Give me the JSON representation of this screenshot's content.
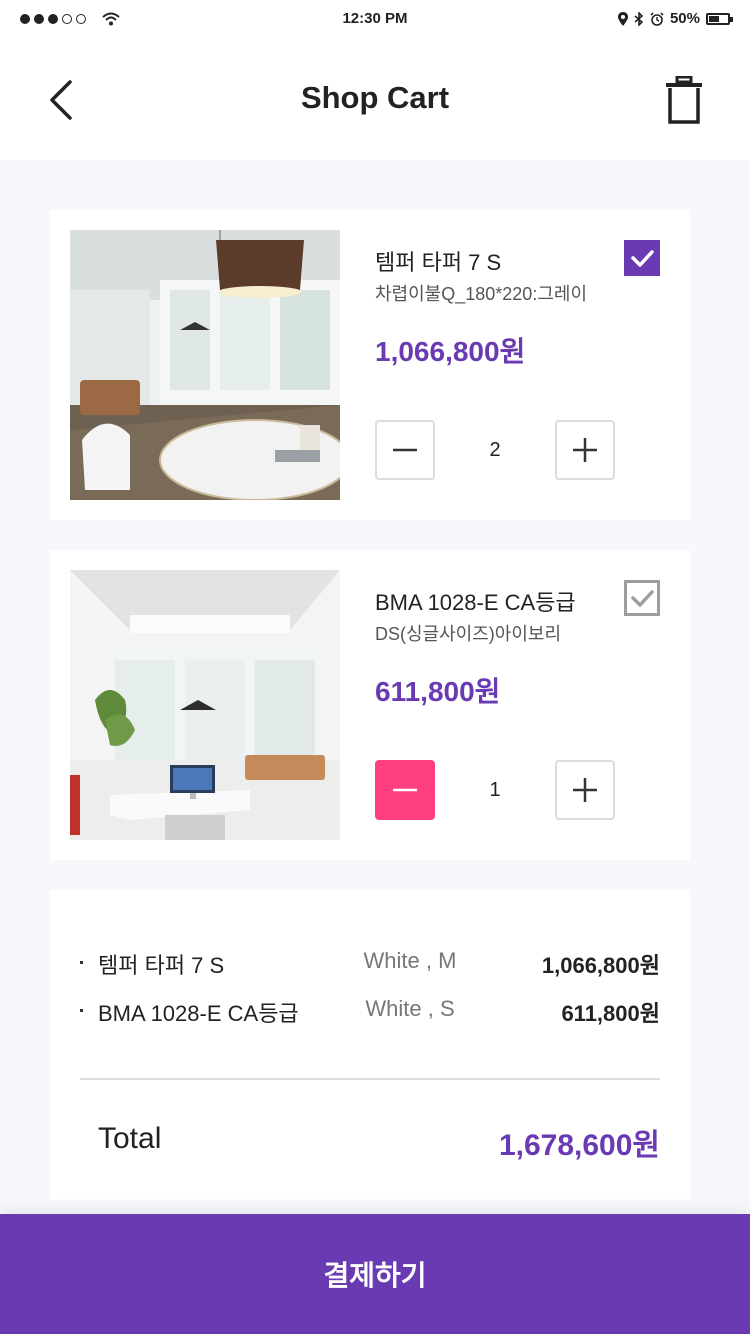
{
  "status_bar": {
    "time": "12:30 PM",
    "battery": "50%",
    "signal_dots_filled": 3,
    "signal_dots_total": 5
  },
  "header": {
    "title": "Shop Cart",
    "back_icon": "chevron-left-icon",
    "trash_icon": "trash-icon"
  },
  "cart": {
    "items": [
      {
        "name": "템퍼 타퍼 7 S",
        "option": "차렵이불Q_180*220:그레이",
        "price": "1,066,800원",
        "quantity": "2",
        "checked": true,
        "minus_active": false
      },
      {
        "name": "BMA 1028-E CA등급",
        "option": "DS(싱글사이즈)아이보리",
        "price": "611,800원",
        "quantity": "1",
        "checked": false,
        "minus_active": true
      }
    ]
  },
  "summary": {
    "rows": [
      {
        "name": "템퍼 타퍼 7 S",
        "option": "White , M",
        "price": "1,066,800원"
      },
      {
        "name": "BMA 1028-E CA등급",
        "option": "White , S",
        "price": "611,800원"
      }
    ],
    "total_label": "Total",
    "total_value": "1,678,600원"
  },
  "pay_button": {
    "label": "결제하기"
  },
  "colors": {
    "accent": "#6a3ab2",
    "minus_active": "#ff3f7f",
    "background": "#f7f8fc"
  }
}
